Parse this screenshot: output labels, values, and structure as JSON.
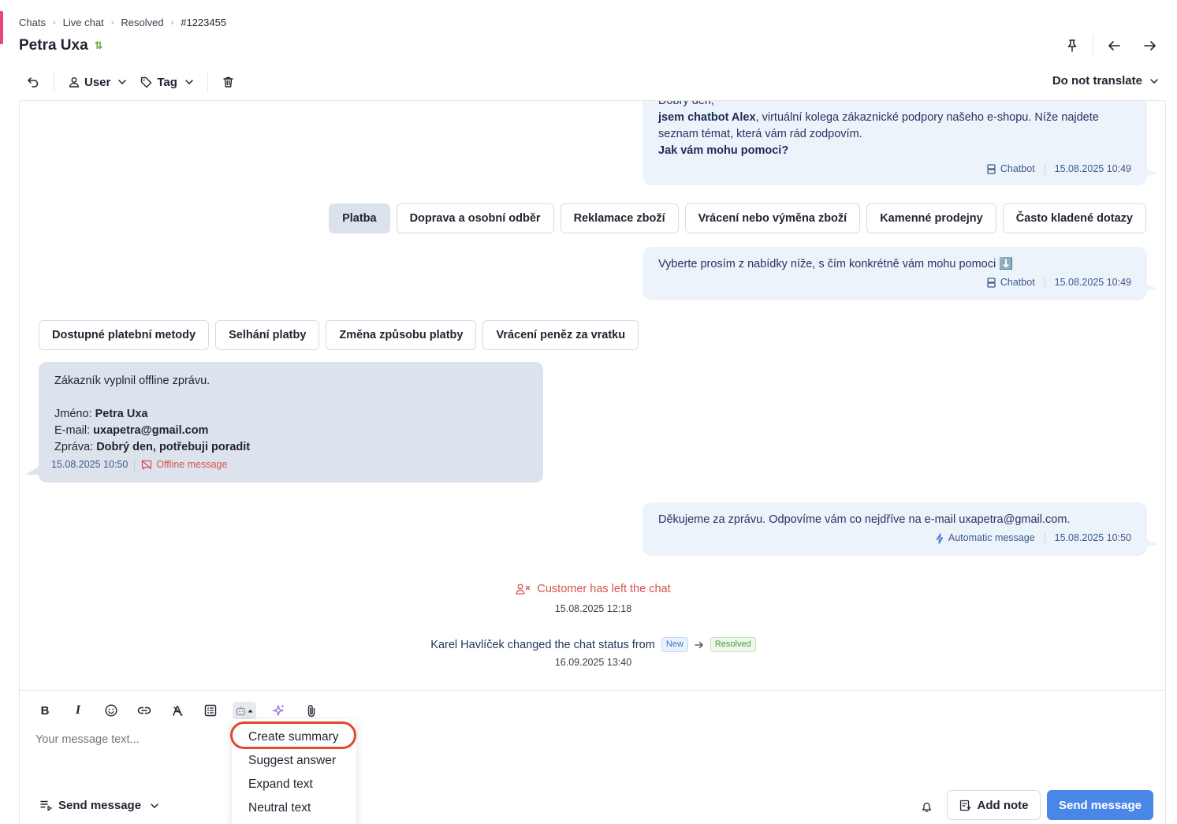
{
  "breadcrumb": {
    "items": [
      "Chats",
      "Live chat",
      "Resolved"
    ],
    "current": "#1223455"
  },
  "header": {
    "title": "Petra Uxa",
    "title_badge": "⇅"
  },
  "toolbar": {
    "user_label": "User",
    "tag_label": "Tag",
    "translate_label": "Do not translate"
  },
  "messages": {
    "bot_intro": {
      "line0": "Dobrý den,",
      "line1_bold": "jsem chatbot Alex",
      "line1_rest": ", virtuální kolega zákaznické podpory našeho e-shopu. Níže najdete",
      "line2": "seznam témat, která vám rád zodpovím.",
      "line3_bold": "Jak vám mohu pomoci?",
      "sender": "Chatbot",
      "time": "15.08.2025 10:49"
    },
    "topic_options": [
      "Platba",
      "Doprava a osobní odběr",
      "Reklamace zboží",
      "Vrácení nebo výměna zboží",
      "Kamenné prodejny",
      "Často kladené dotazy"
    ],
    "bot_select": {
      "text": "Vyberte prosím z nabídky níže, s čím konkrétně vám mohu pomoci ⬇️",
      "sender": "Chatbot",
      "time": "15.08.2025 10:49"
    },
    "payment_options": [
      "Dostupné platební metody",
      "Selhání platby",
      "Změna způsobu platby",
      "Vrácení peněz za vratku"
    ],
    "offline": {
      "intro": "Zákazník vyplnil offline zprávu.",
      "name_label": "Jméno: ",
      "name_value": "Petra Uxa",
      "email_label": "E-mail: ",
      "email_value": "uxapetra@gmail.com",
      "msg_label": "Zpráva: ",
      "msg_value": "Dobrý den, potřebuji poradit",
      "time": "15.08.2025 10:50",
      "type": "Offline message"
    },
    "auto_reply": {
      "text": "Děkujeme za zprávu. Odpovíme vám co nejdříve na e-mail uxapetra@gmail.com.",
      "type": "Automatic message",
      "time": "15.08.2025 10:50"
    },
    "left_chat": {
      "text": "Customer has left the chat",
      "time": "15.08.2025 12:18"
    },
    "status_change": {
      "text": "Karel Havlíček changed the chat status from",
      "from": "New",
      "to": "Resolved",
      "time": "16.09.2025 13:40"
    }
  },
  "composer": {
    "placeholder": "Your message text...",
    "send_mode": "Send message",
    "add_note": "Add note",
    "send_button": "Send message"
  },
  "ai_menu": {
    "items": [
      "Create summary",
      "Suggest answer",
      "Expand text",
      "Neutral text"
    ]
  },
  "colors": {
    "accent": "#4a86e8",
    "alert": "#d9534f",
    "highlight_ring": "#e0492b",
    "left_accent": "#e8457f"
  }
}
